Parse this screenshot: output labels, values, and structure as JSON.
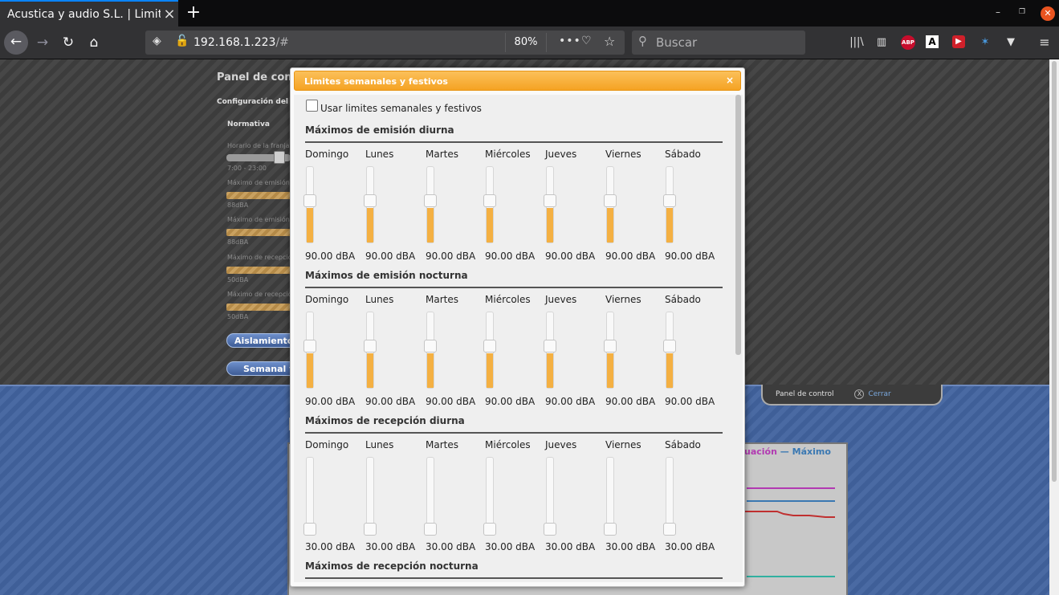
{
  "browser": {
    "tab_title": "Acustica y audio S.L. | Limita",
    "url_host": "192.168.1.223",
    "url_path": "/#",
    "zoom": "80%",
    "search_placeholder": "Buscar",
    "extension_abp": "ABP",
    "extension_a": "A"
  },
  "background": {
    "panel_title": "Panel de contr",
    "config_label": "Configuración del e",
    "normativa": "Normativa",
    "horario_label": "Horario de la franja",
    "horario_value": "7:00 - 23:00",
    "rows": [
      {
        "label": "Máximo de emisión",
        "value": "88dBA"
      },
      {
        "label": "Máximo de emisión",
        "value": "88dBA"
      },
      {
        "label": "Máximo de recepció",
        "value": "50dBA"
      },
      {
        "label": "Máximo de recepció",
        "value": "50dBA"
      }
    ],
    "btn_aislamiento": "Aislamiento",
    "btn_semanal": "Semanal y",
    "tab_panel": "Panel de control",
    "tab_close_icon": "X",
    "tab_cerrar": "Cerrar",
    "chart_legend_a": "uación",
    "chart_legend_sep": "—",
    "chart_legend_b": "Máximo",
    "colors": {
      "purple": "#b23ab2",
      "blue": "#3a78b2",
      "red": "#c03030",
      "teal": "#30b0a0"
    }
  },
  "dialog": {
    "title": "Limites semanales y festivos",
    "close": "×",
    "checkbox_label": "Usar limites semanales y festivos",
    "checkbox_checked": false,
    "accent": "#f4b042",
    "days": [
      "Domingo",
      "Lunes",
      "Martes",
      "Miércoles",
      "Jueves",
      "Viernes",
      "Sábado"
    ],
    "sections": [
      {
        "title": "Máximos de emisión diurna",
        "fill_fraction": 0.5,
        "values": [
          "90.00 dBA",
          "90.00 dBA",
          "90.00 dBA",
          "90.00 dBA",
          "90.00 dBA",
          "90.00 dBA",
          "90.00 dBA"
        ]
      },
      {
        "title": "Máximos de emisión nocturna",
        "fill_fraction": 0.5,
        "values": [
          "90.00 dBA",
          "90.00 dBA",
          "90.00 dBA",
          "90.00 dBA",
          "90.00 dBA",
          "90.00 dBA",
          "90.00 dBA"
        ]
      },
      {
        "title": "Máximos de recepción diurna",
        "fill_fraction": 0.0,
        "values": [
          "30.00 dBA",
          "30.00 dBA",
          "30.00 dBA",
          "30.00 dBA",
          "30.00 dBA",
          "30.00 dBA",
          "30.00 dBA"
        ]
      },
      {
        "title": "Máximos de recepción nocturna"
      }
    ]
  }
}
